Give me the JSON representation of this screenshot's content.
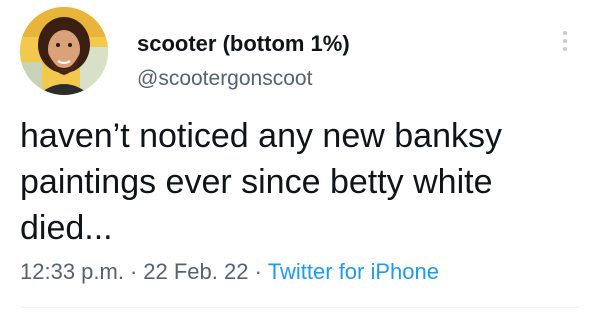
{
  "author": {
    "display_name": "scooter (bottom 1%)",
    "handle": "@scootergonscoot"
  },
  "tweet": {
    "text_lines": [
      "haven’t noticed any new banksy",
      "paintings ever since betty white",
      "died..."
    ]
  },
  "meta": {
    "time": "12:33 p.m.",
    "separator": "·",
    "date": "22 Feb. 22",
    "source": "Twitter for iPhone"
  },
  "icons": {
    "more": "more-vertical-icon",
    "avatar": "profile-photo"
  },
  "colors": {
    "text": "#0f1419",
    "secondary": "#536471",
    "link": "#1d9bf0",
    "divider": "#eff3f4"
  }
}
